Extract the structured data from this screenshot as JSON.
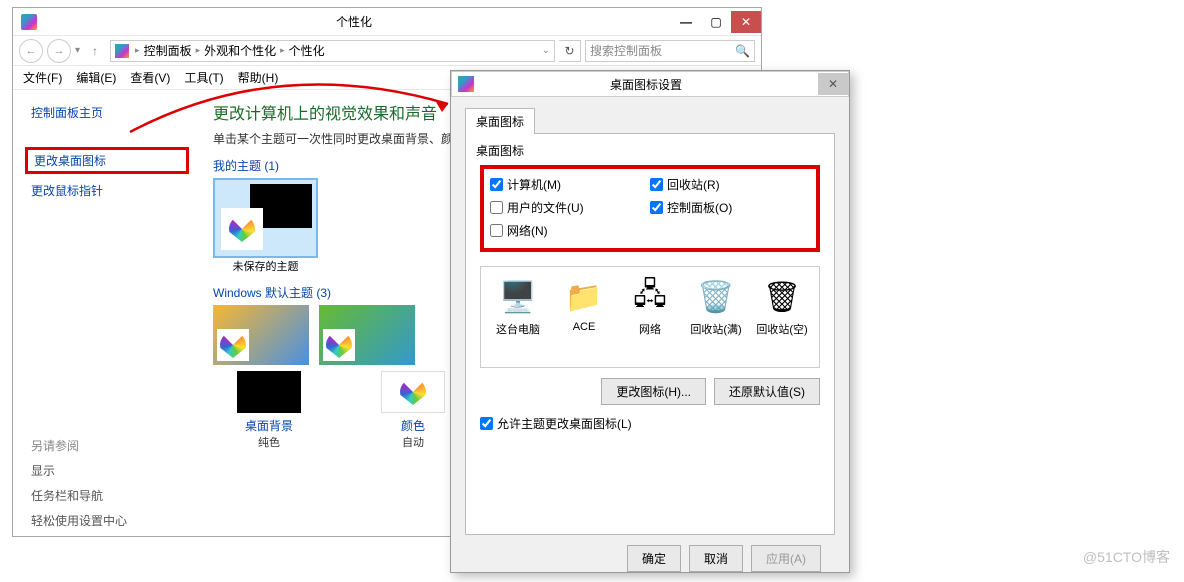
{
  "main_window": {
    "title": "个性化",
    "menu": {
      "file": "文件(F)",
      "edit": "编辑(E)",
      "view": "查看(V)",
      "tools": "工具(T)",
      "help": "帮助(H)"
    },
    "breadcrumb": {
      "root": "控制面板",
      "level2": "外观和个性化",
      "level3": "个性化"
    },
    "search_placeholder": "搜索控制面板",
    "sidebar": {
      "home": "控制面板主页",
      "change_desktop_icons": "更改桌面图标",
      "change_mouse_pointers": "更改鼠标指针",
      "see_also": "另请参阅",
      "display": "显示",
      "taskbar_nav": "任务栏和导航",
      "ease_center": "轻松使用设置中心"
    },
    "heading": "更改计算机上的视觉效果和声音",
    "subheading": "单击某个主题可一次性同时更改桌面背景、颜色、",
    "my_themes_hdr": "我的主题 (1)",
    "unsaved_theme": "未保存的主题",
    "win_default_hdr": "Windows 默认主题 (3)",
    "bottom": {
      "bg_label": "桌面背景",
      "bg_value": "纯色",
      "color_label": "颜色",
      "color_value": "自动"
    }
  },
  "dialog": {
    "title": "桌面图标设置",
    "tab": "桌面图标",
    "fieldset": "桌面图标",
    "checks": {
      "computer": "计算机(M)",
      "recycle": "回收站(R)",
      "userfiles": "用户的文件(U)",
      "cpl": "控制面板(O)",
      "network": "网络(N)"
    },
    "icons": {
      "this_pc": "这台电脑",
      "ace": "ACE",
      "net": "网络",
      "rb_full": "回收站(满)",
      "rb_empty": "回收站(空)"
    },
    "change_icon": "更改图标(H)...",
    "restore_default": "还原默认值(S)",
    "allow_themes": "允许主题更改桌面图标(L)",
    "ok": "确定",
    "cancel": "取消",
    "apply": "应用(A)"
  },
  "watermark": "@51CTO博客"
}
